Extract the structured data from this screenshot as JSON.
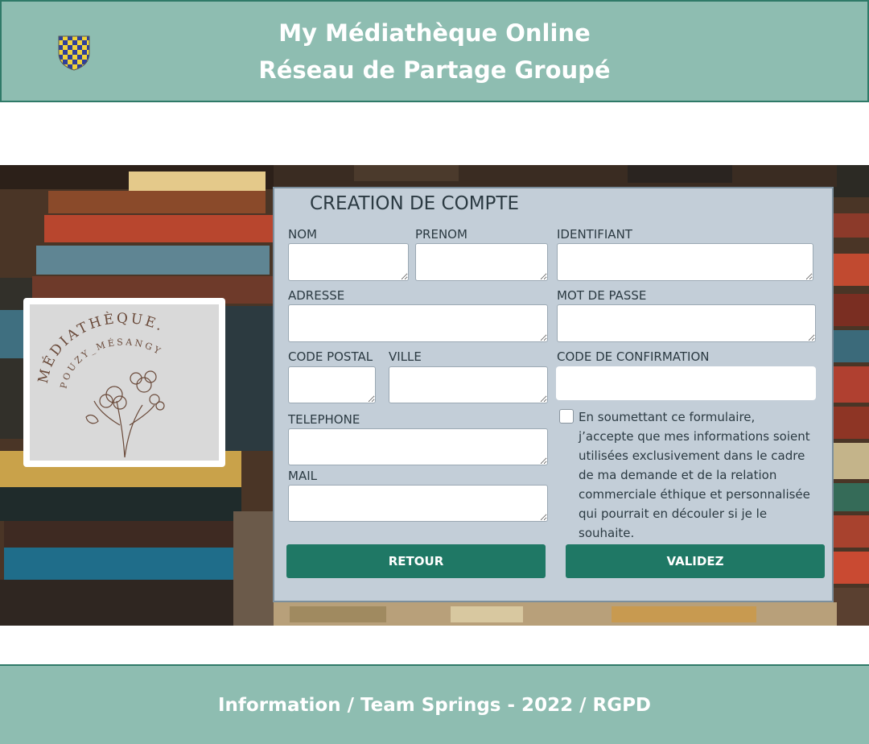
{
  "header": {
    "title_line1": "My Médiathèque Online",
    "title_line2": "Réseau de Partage Groupé",
    "crest_icon": "checkered-shield-crest"
  },
  "logo": {
    "line1": "MÉDIATHÈQUE.",
    "line2": "POUZY_MÉSANGY"
  },
  "form": {
    "title": "CREATION DE COMPTE",
    "labels": {
      "nom": "NOM",
      "prenom": "PRENOM",
      "identifiant": "IDENTIFIANT",
      "adresse": "ADRESSE",
      "mot_de_passe": "MOT DE PASSE",
      "code_postal": "CODE POSTAL",
      "ville": "VILLE",
      "code_confirmation": "CODE DE CONFIRMATION",
      "telephone": "TELEPHONE",
      "mail": "MAIL"
    },
    "values": {
      "nom": "",
      "prenom": "",
      "identifiant": "",
      "adresse": "",
      "mot_de_passe": "",
      "code_postal": "",
      "ville": "",
      "code_confirmation": "",
      "telephone": "",
      "mail": ""
    },
    "consent_checked": false,
    "consent_text": "En soumettant ce formulaire, j’accepte que mes informations soient utilisées exclusivement dans le cadre de ma demande et de la relation commerciale éthique et personnalisée qui pourrait en découler si je le souhaite.",
    "retour_label": "RETOUR",
    "valider_label": "VALIDEZ"
  },
  "footer": {
    "text": "Information / Team Springs - 2022 / RGPD"
  },
  "colors": {
    "header_bg": "#8ebdb1",
    "border": "#2f7a68",
    "panel_bg": "#c3ced8",
    "button_bg": "#1f7865"
  }
}
